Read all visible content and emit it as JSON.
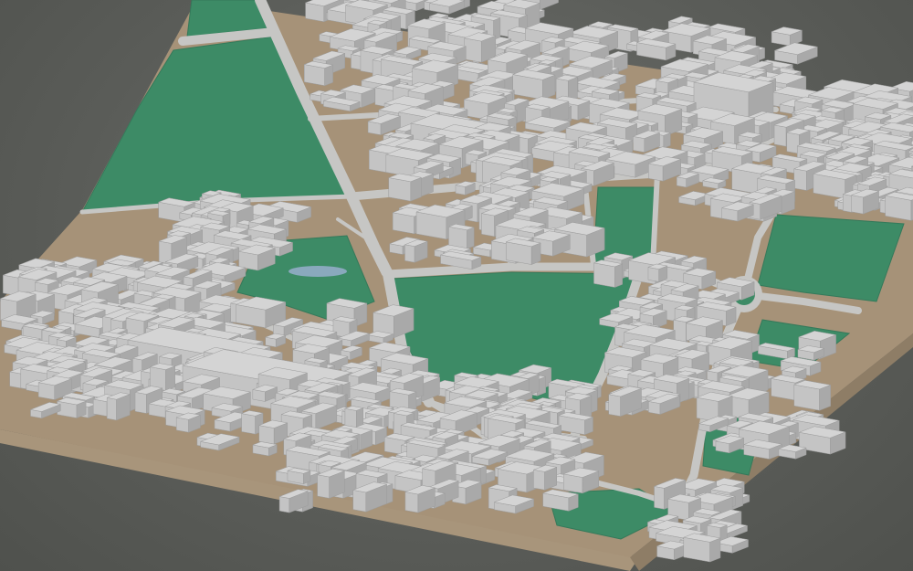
{
  "scene": {
    "kind": "3d-city-block-model",
    "colors": {
      "background": "#5c5e5a",
      "base_side": "#a8957b",
      "base_side_dark": "#8e7d66",
      "ground": "#a69278",
      "park": "#3d8b66",
      "park_dark": "#35795a",
      "road": "#c6c6c4",
      "building_roof": "#d4d4d4",
      "building_light": "#c4c4c4",
      "building_shade": "#a9a9a9",
      "water": "#8aa9bd"
    },
    "parks": [
      {
        "name": "north-west-park"
      },
      {
        "name": "central-park"
      },
      {
        "name": "east-park"
      },
      {
        "name": "north-small-park"
      },
      {
        "name": "south-park"
      },
      {
        "name": "pond-park"
      }
    ],
    "water_bodies": [
      {
        "name": "pond"
      }
    ],
    "roundabouts": [
      {
        "name": "east-roundabout"
      }
    ]
  }
}
